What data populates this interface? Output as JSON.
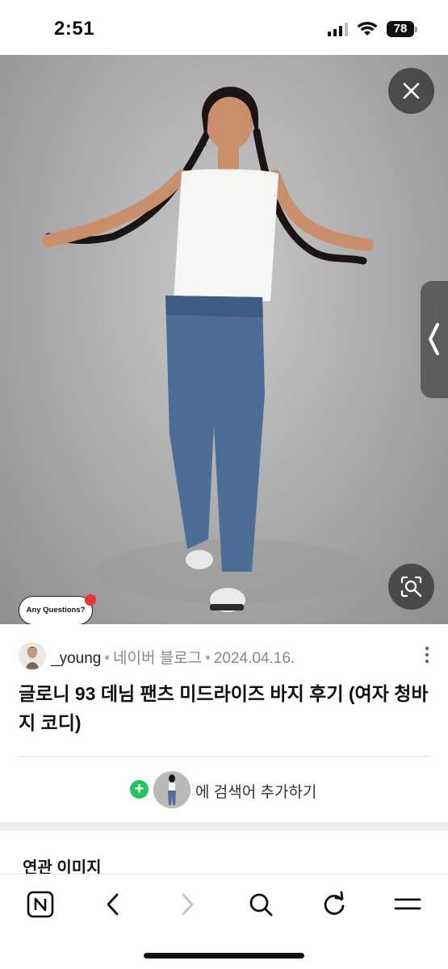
{
  "status_bar": {
    "time": "2:51",
    "battery": "78"
  },
  "image_overlay": {
    "badge_text": "Any Questions?",
    "icons": [
      "close-icon",
      "chevron-left-icon",
      "lens-search-icon"
    ]
  },
  "post": {
    "author": "_young",
    "source": "네이버 블로그",
    "date": "2024.04.16.",
    "separator": "•",
    "title": "글로니 93 데님 팬츠 미드라이즈 바지 후기 (여자 청바지 코디)",
    "add_search_label": "에 검색어 추가하기"
  },
  "related_heading": "연관 이미지",
  "toolbar": {
    "items": [
      "naver-home-icon",
      "back-icon",
      "forward-icon",
      "search-icon",
      "refresh-icon",
      "menu-icon"
    ]
  },
  "colors": {
    "accent_green": "#22c55e",
    "badge_dot": "#e33333"
  }
}
